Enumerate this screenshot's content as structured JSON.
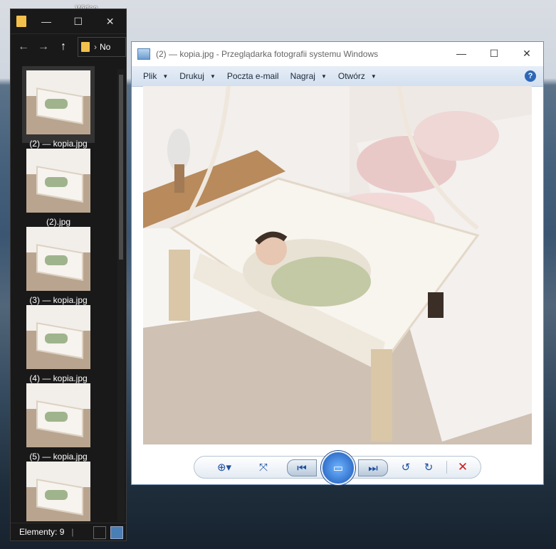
{
  "desktop": {
    "icon_label_lines": [
      "Wideo",
      "mate"
    ]
  },
  "explorer": {
    "address_text": "No",
    "files": [
      {
        "label": "(2) — kopia.jpg"
      },
      {
        "label": "(2).jpg"
      },
      {
        "label": "(3) — kopia.jpg"
      },
      {
        "label": "(4) — kopia.jpg"
      },
      {
        "label": "(5) — kopia.jpg"
      },
      {
        "label": ""
      }
    ],
    "status_count": "Elementy: 9",
    "status_sep": "|"
  },
  "viewer": {
    "title": "(2) — kopia.jpg - Przeglądarka fotografii systemu Windows",
    "menu": [
      {
        "label": "Plik"
      },
      {
        "label": "Drukuj"
      },
      {
        "label": "Poczta e-mail"
      },
      {
        "label": "Nagraj"
      },
      {
        "label": "Otwórz"
      }
    ],
    "help_glyph": "?",
    "toolbar_icons": [
      "zoom-icon",
      "fit-icon",
      "previous-icon",
      "slideshow-icon",
      "next-icon",
      "rotate-left-icon",
      "rotate-right-icon",
      "delete-icon"
    ]
  },
  "colors": {
    "accent": "#2f67b7",
    "delete": "#c82020",
    "explorer_bg": "#191919"
  }
}
